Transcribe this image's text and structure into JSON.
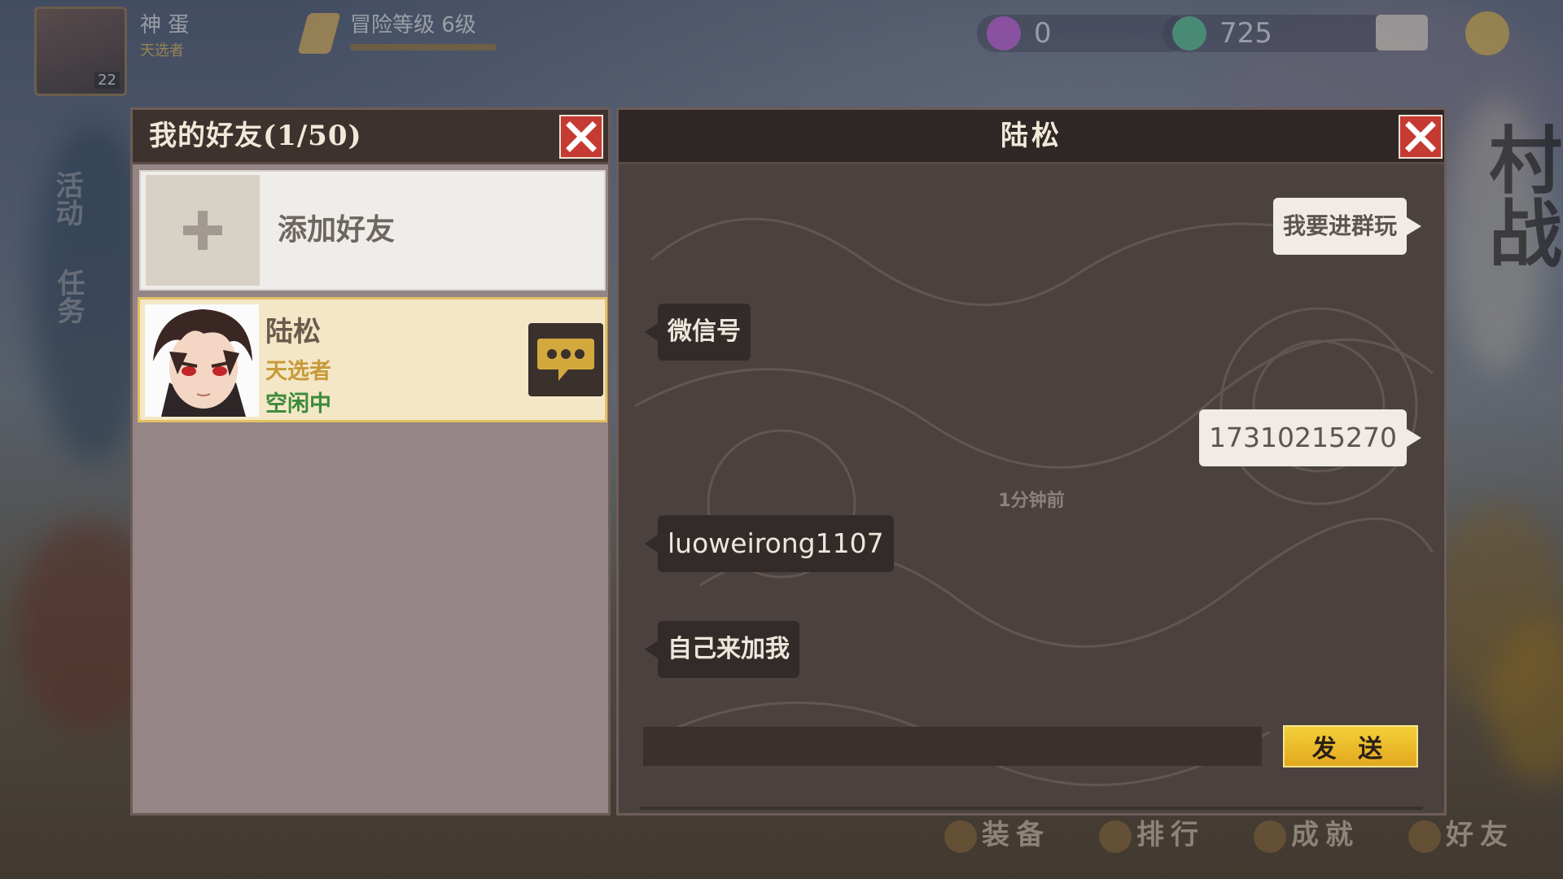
{
  "hud": {
    "player_name": "神 蛋",
    "player_subtitle": "天选者",
    "player_level": "22",
    "rank_label": "冒险等级 6级",
    "resource_1": "0",
    "resource_2": "725"
  },
  "side_labels": {
    "left_1": "活动",
    "left_2": "任务",
    "right": "村战"
  },
  "bottom_nav": [
    "装备",
    "排行",
    "成就",
    "好友"
  ],
  "friends_panel": {
    "title": "我的好友(1/50)",
    "add_friend_label": "添加好友",
    "friends": [
      {
        "name": "陆松",
        "title": "天选者",
        "status": "空闲中"
      }
    ]
  },
  "chat": {
    "title": "陆松",
    "messages": [
      {
        "side": "mine",
        "text": "我要进群玩"
      },
      {
        "side": "theirs",
        "text": "微信号"
      },
      {
        "side": "mine",
        "text": "17310215270"
      },
      {
        "side": "time",
        "text": "1分钟前"
      },
      {
        "side": "theirs",
        "text": "luoweirong1107"
      },
      {
        "side": "theirs",
        "text": "自己来加我"
      }
    ],
    "input_value": "",
    "input_placeholder": "",
    "send_label": "发 送"
  },
  "colors": {
    "close_red": "#c53a32",
    "send_yellow": "#f3cf3a",
    "title_gold": "#c79a3a",
    "status_green": "#3d8a3a"
  }
}
